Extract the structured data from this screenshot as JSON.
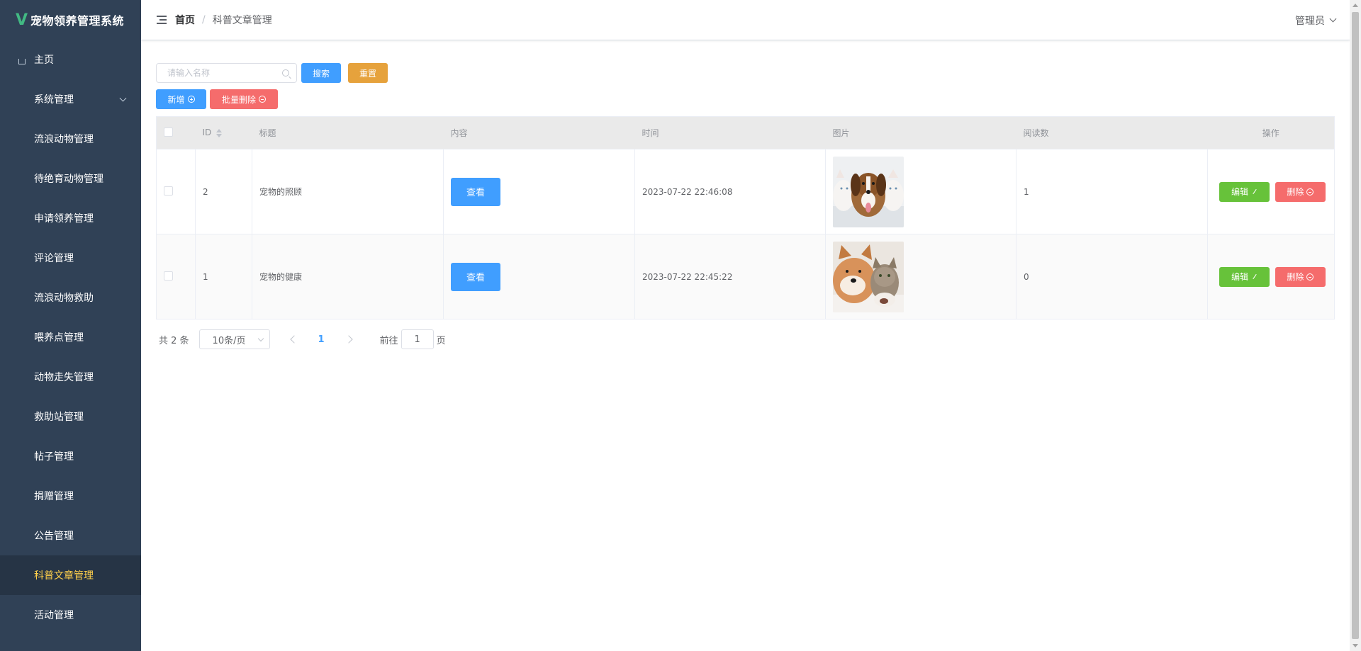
{
  "app": {
    "title": "宠物领养管理系统",
    "logo_letter": "V"
  },
  "sidebar": {
    "items": [
      {
        "label": "主页",
        "icon": "home-icon"
      },
      {
        "label": "系统管理",
        "icon": "grid9-icon",
        "has_submenu": true
      },
      {
        "label": "流浪动物管理",
        "icon": "grid-icon"
      },
      {
        "label": "待绝育动物管理",
        "icon": "grid-icon"
      },
      {
        "label": "申请领养管理",
        "icon": "grid-icon"
      },
      {
        "label": "评论管理",
        "icon": "grid-icon"
      },
      {
        "label": "流浪动物救助",
        "icon": "grid-icon"
      },
      {
        "label": "喂养点管理",
        "icon": "grid-icon"
      },
      {
        "label": "动物走失管理",
        "icon": "grid-icon"
      },
      {
        "label": "救助站管理",
        "icon": "grid-icon"
      },
      {
        "label": "帖子管理",
        "icon": "grid-icon"
      },
      {
        "label": "捐赠管理",
        "icon": "grid-icon"
      },
      {
        "label": "公告管理",
        "icon": "grid-icon"
      },
      {
        "label": "科普文章管理",
        "icon": "grid-icon",
        "active": true
      },
      {
        "label": "活动管理",
        "icon": "grid-icon"
      }
    ],
    "bg_color": "#304156",
    "active_color": "#ffd04b"
  },
  "header": {
    "breadcrumb": [
      "首页",
      "科普文章管理"
    ],
    "user": "管理员"
  },
  "search": {
    "placeholder": "请输入名称",
    "value": ""
  },
  "buttons": {
    "search": "搜索",
    "reset": "重置",
    "add": "新增",
    "batch_delete": "批量删除",
    "view": "查看",
    "edit": "编辑",
    "delete": "删除"
  },
  "table": {
    "columns": [
      "ID",
      "标题",
      "内容",
      "时间",
      "图片",
      "阅读数",
      "操作"
    ],
    "rows": [
      {
        "id": "2",
        "title": "宠物的照顾",
        "time": "2023-07-22 22:46:08",
        "image": "puppy-kittens",
        "reads": "1"
      },
      {
        "id": "1",
        "title": "宠物的健康",
        "time": "2023-07-22 22:45:22",
        "image": "shiba-cat",
        "reads": "0"
      }
    ]
  },
  "pagination": {
    "total": "共 2 条",
    "page_size": "10条/页",
    "current_page": "1",
    "goto_label": "前往",
    "goto_value": "1",
    "page_suffix": "页"
  },
  "colors": {
    "primary": "#409eff",
    "warning": "#e6a23c",
    "danger": "#f56c6c",
    "success": "#67c23a"
  }
}
